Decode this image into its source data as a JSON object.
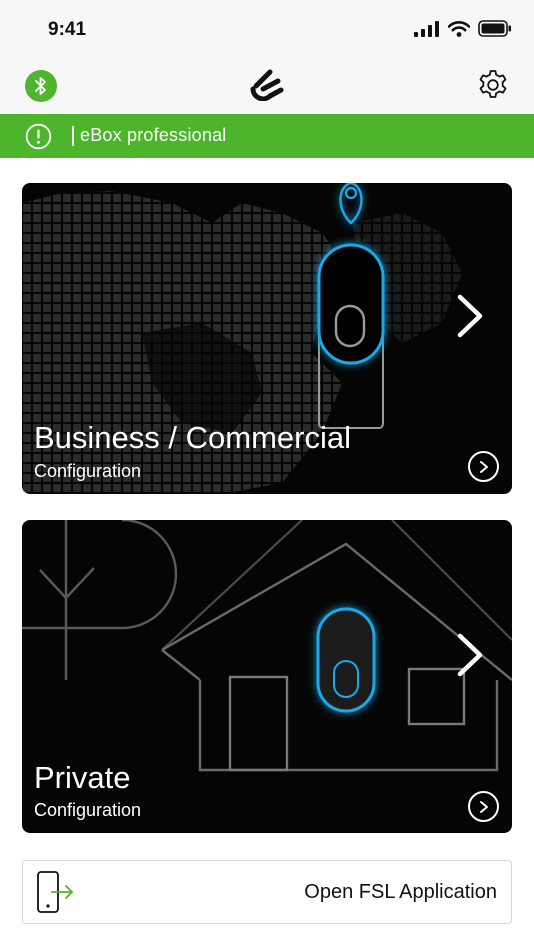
{
  "status_bar": {
    "time": "9:41",
    "icons": [
      "cellular-signal-icon",
      "wifi-icon",
      "battery-icon"
    ]
  },
  "header": {
    "left_icon": "bluetooth-icon",
    "logo_icon": "ebox-logo-icon",
    "right_icon": "gear-icon"
  },
  "banner": {
    "icon": "alert-circle-icon",
    "text": "eBox professional"
  },
  "cards": [
    {
      "title": "Business / Commercial",
      "subtitle": "Configuration",
      "arrow_icon": "chevron-right-icon",
      "go_icon": "chevron-right-circle-icon"
    },
    {
      "title": "Private",
      "subtitle": "Configuration",
      "arrow_icon": "chevron-right-icon",
      "go_icon": "chevron-right-circle-icon"
    }
  ],
  "fsl_button": {
    "icon": "phone-open-app-icon",
    "label": "Open FSL Application"
  },
  "colors": {
    "brand_green": "#4cb52b",
    "card_background": "#050505",
    "glow_blue": "#1fa8e6"
  }
}
